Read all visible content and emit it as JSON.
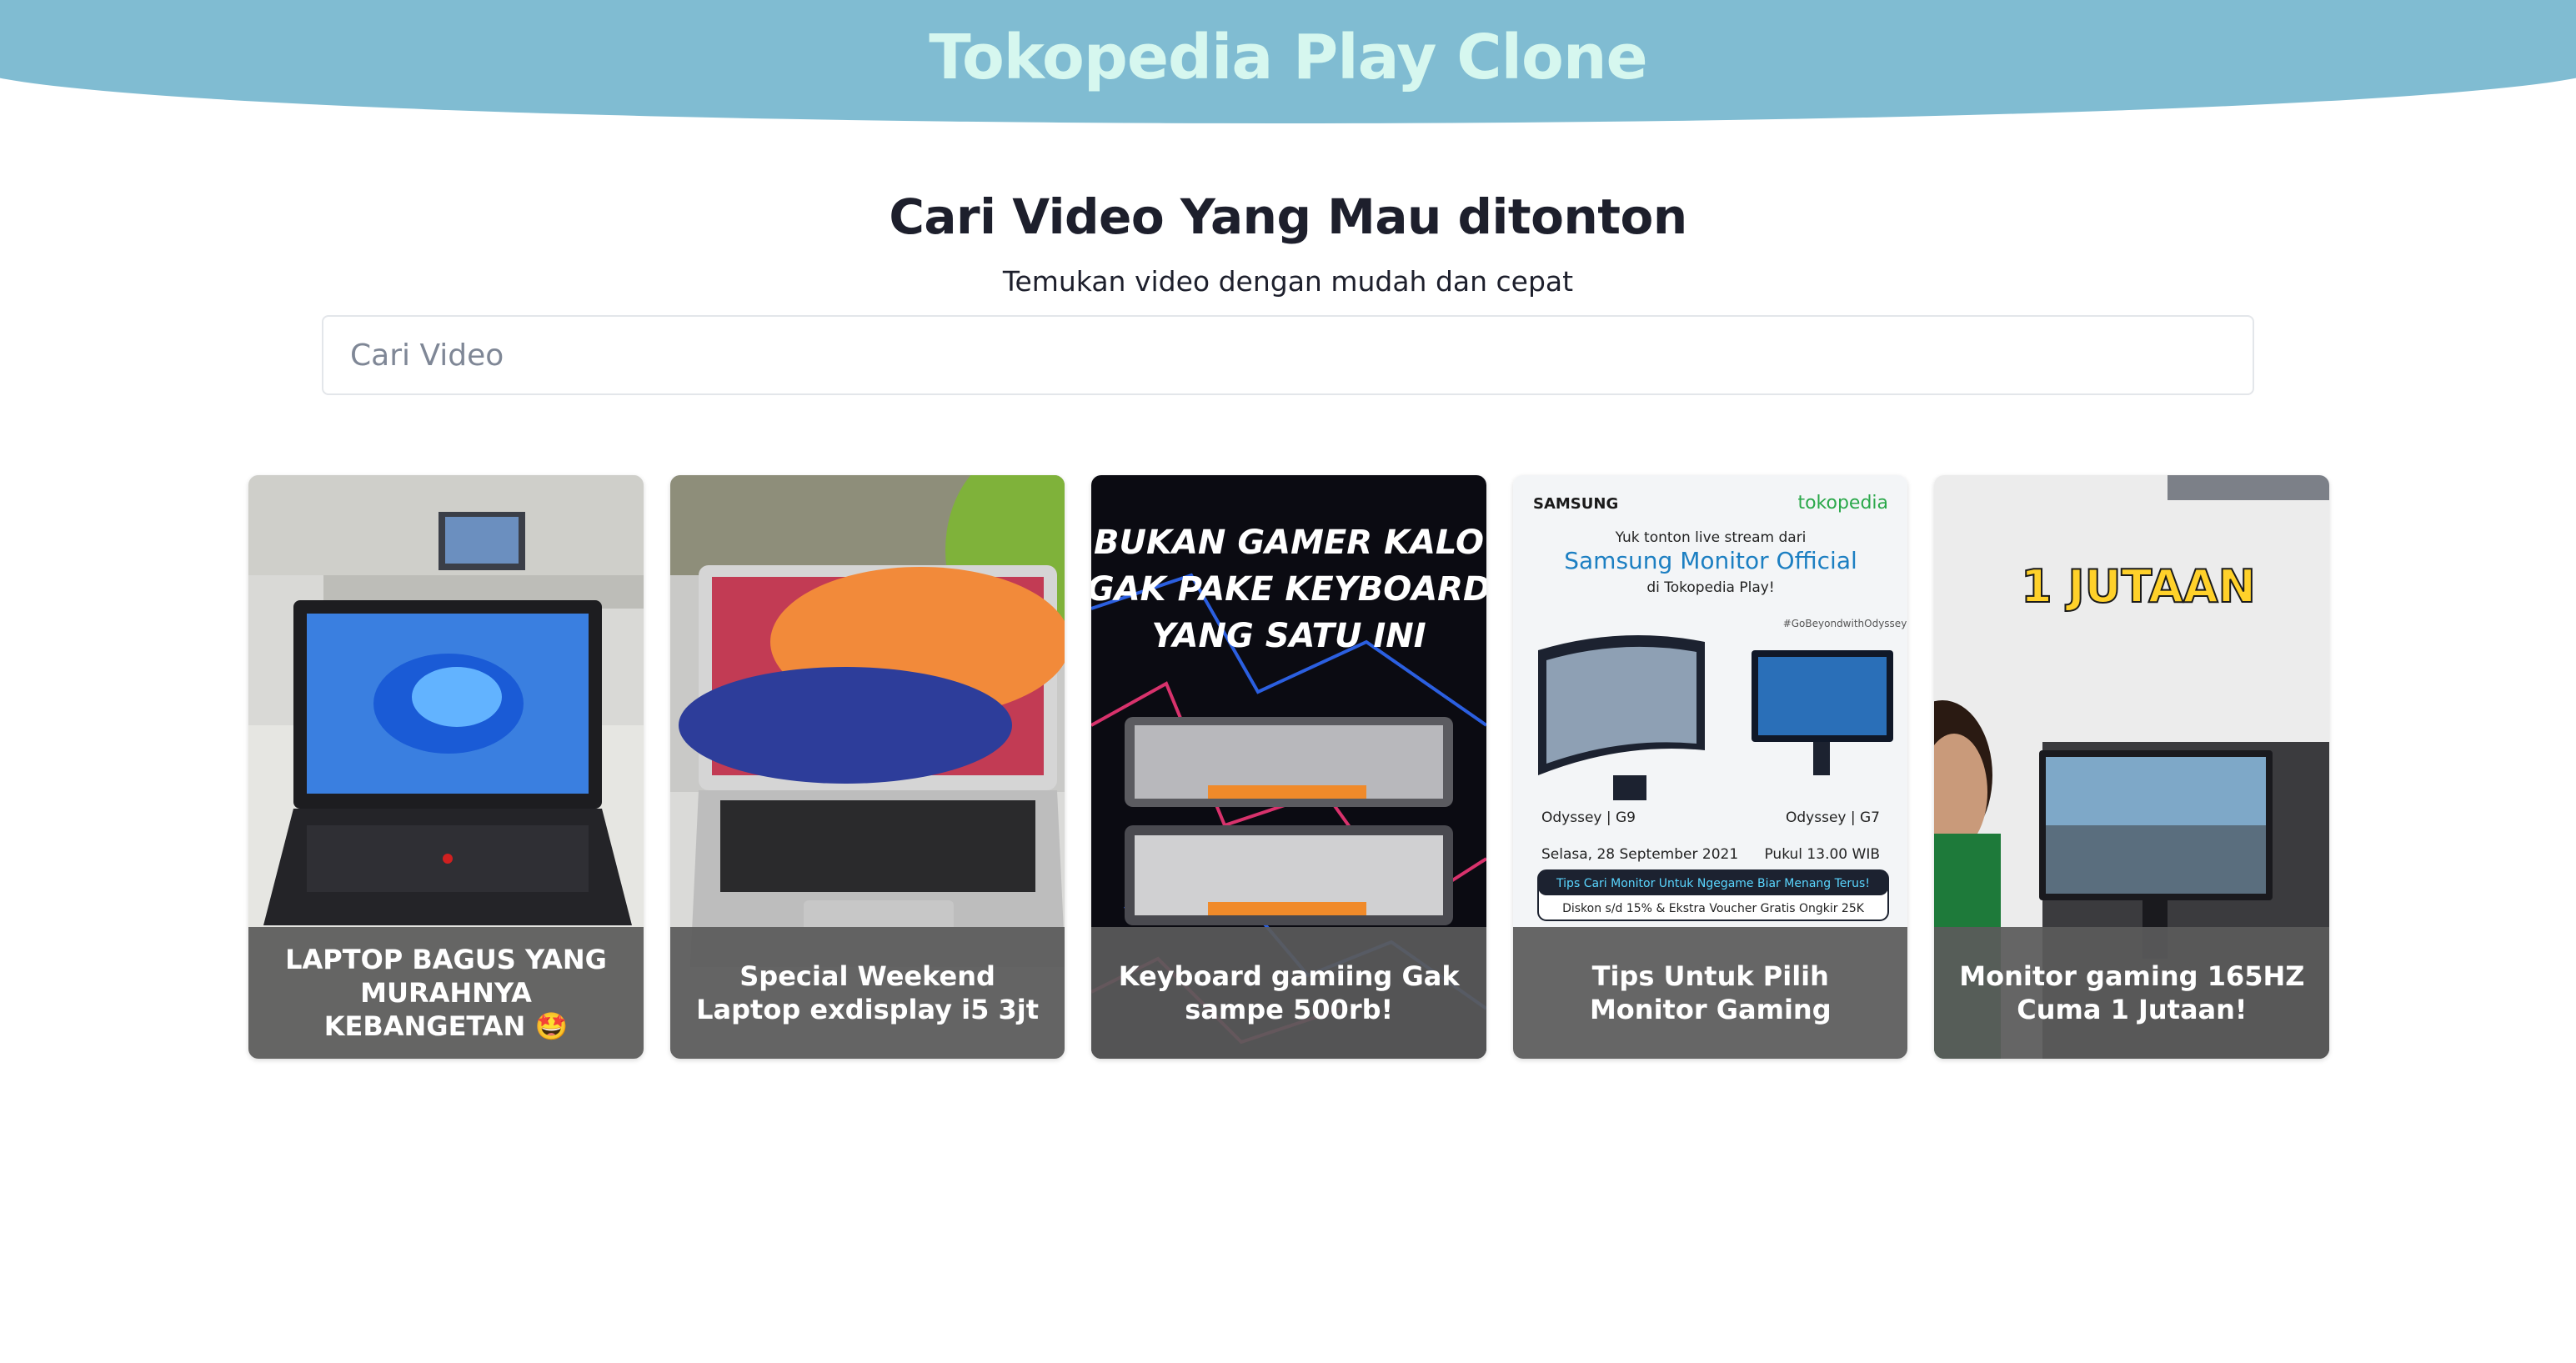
{
  "header": {
    "title": "Tokopedia Play Clone"
  },
  "hero": {
    "title": "Cari Video Yang Mau ditonton",
    "subtitle": "Temukan video dengan mudah dan cepat"
  },
  "search": {
    "placeholder": "Cari Video",
    "value": ""
  },
  "videos": [
    {
      "title": "LAPTOP BAGUS YANG MURAHNYA KEBANGETAN 🤩"
    },
    {
      "title": "Special Weekend Laptop exdisplay i5 3jt"
    },
    {
      "title": "Keyboard gamiing Gak sampe 500rb!",
      "thumb_text": [
        "BUKAN GAMER KALO",
        "GAK PAKE KEYBOARD",
        "YANG SATU INI"
      ]
    },
    {
      "title": "Tips Untuk Pilih Monitor Gaming",
      "thumb_text": {
        "brand_left": "SAMSUNG",
        "brand_right": "tokopedia",
        "line1": "Yuk tonton live stream dari",
        "line2": "Samsung Monitor Official",
        "line3": "di Tokopedia Play!",
        "hashtag": "#GoBeyondwithOdyssey",
        "model_left": "Odyssey | G9",
        "model_right": "Odyssey | G7",
        "date": "Selasa, 28 September 2021",
        "time": "Pukul 13.00 WIB",
        "tip": "Tips Cari Monitor Untuk Ngegame Biar Menang Terus!",
        "promo": "Diskon s/d 15% & Ekstra Voucher Gratis Ongkir 25K"
      }
    },
    {
      "title": "Monitor gaming 165HZ Cuma 1 Jutaan!",
      "thumb_text": "1 JUTAAN"
    }
  ],
  "colors": {
    "header": "#80bcd2",
    "header_text": "#d6f7ef",
    "caption_bg": "#5a5a5a"
  }
}
